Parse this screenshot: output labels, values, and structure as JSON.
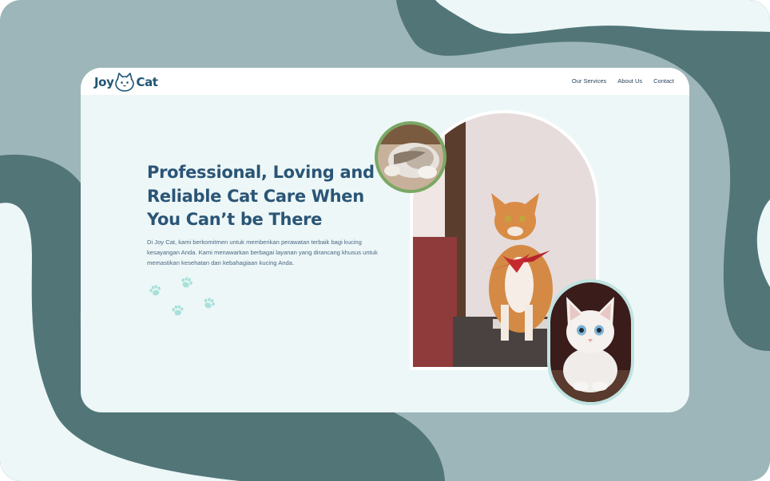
{
  "brand": {
    "word1": "Joy",
    "word2": "Cat"
  },
  "nav": [
    "Our Services",
    "About Us",
    "Contact"
  ],
  "hero": {
    "title": "Professional, Loving and Reliable Cat Care When You Can’t be There",
    "description": "Di Joy Cat, kami berkomitmen untuk memberikan perawatan terbaik bagi kucing kesayangan Anda. Kami menawarkan berbagai layanan yang dirancang khusus untuk memastikan kesehatan dan kebahagiaan kucing Anda."
  },
  "colors": {
    "background": "#9db6b9",
    "wave": "#527578",
    "card": "#edf7f7",
    "heading": "#2a5576",
    "paw": "#a9e0da",
    "circle_border": "#7aa864",
    "oval_border": "#bfe3e1"
  },
  "images": [
    "sleeping-kitten-photo",
    "ginger-cat-bandana-photo",
    "white-kitten-photo"
  ],
  "icons": [
    "paw-icon"
  ]
}
